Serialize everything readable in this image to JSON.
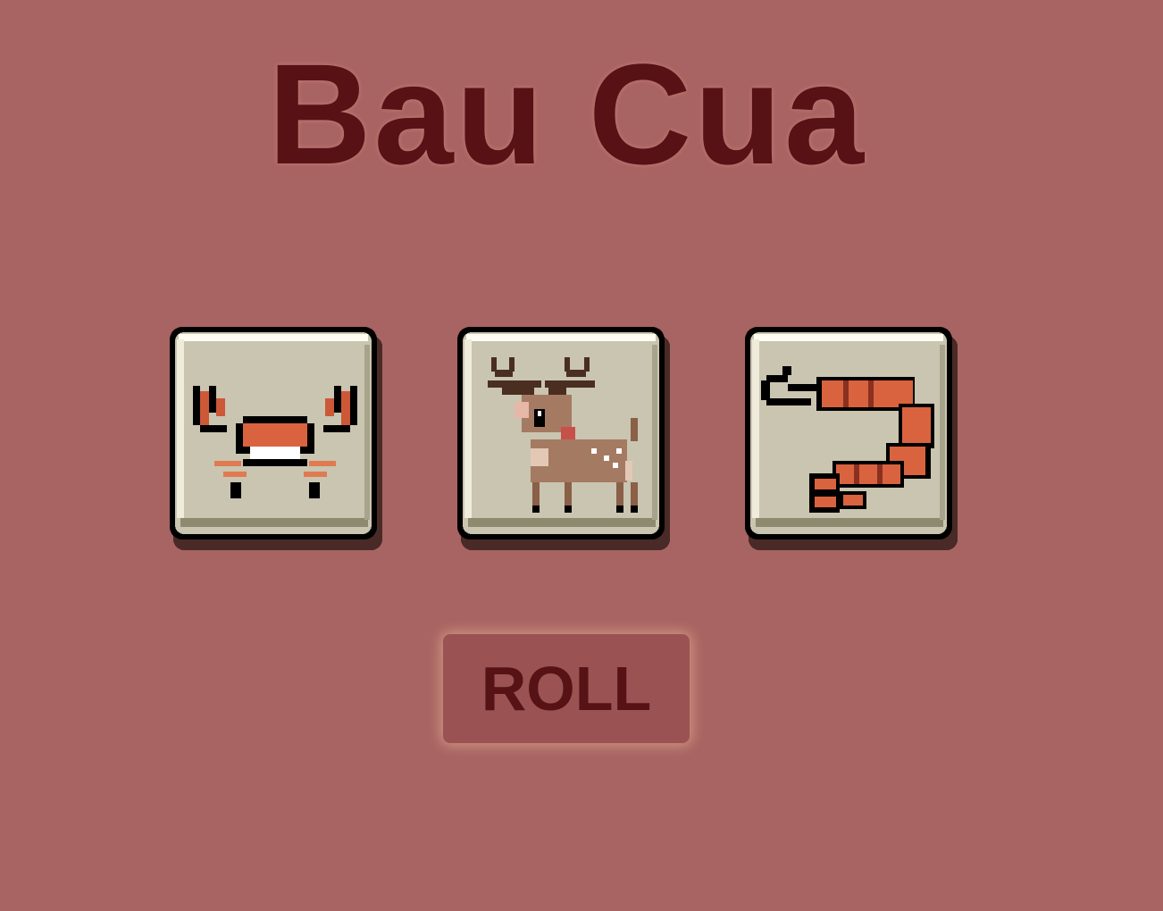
{
  "title": "Bau Cua",
  "dice": [
    {
      "face": "crab",
      "icon": "crab-icon"
    },
    {
      "face": "deer",
      "icon": "deer-icon"
    },
    {
      "face": "shrimp",
      "icon": "shrimp-icon"
    }
  ],
  "roll_button": {
    "label": "ROLL"
  },
  "colors": {
    "background": "#a86462",
    "title": "#561214",
    "die_face": "#c9c5b0",
    "button": "#9a5352"
  }
}
